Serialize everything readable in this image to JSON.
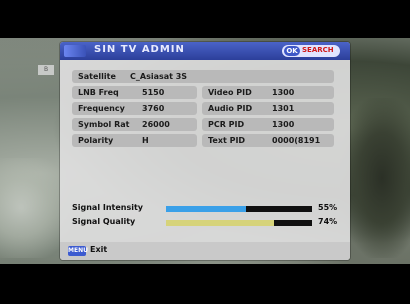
{
  "window": {
    "title": "SIN TV ADMIN",
    "ok_key": "OK",
    "ok_action": "SEARCH",
    "side_tab": "B"
  },
  "info": {
    "satellite_label": "Satellite",
    "satellite_value": "C_Asiasat 3S",
    "lnb_label": "LNB Freq",
    "lnb_value": "5150",
    "frequency_label": "Frequency",
    "frequency_value": "3760",
    "symbol_label": "Symbol Rat",
    "symbol_value": "26000",
    "polarity_label": "Polarity",
    "polarity_value": "H",
    "video_pid_label": "Video PID",
    "video_pid_value": "1300",
    "audio_pid_label": "Audio PID",
    "audio_pid_value": "1301",
    "pcr_pid_label": "PCR PID",
    "pcr_pid_value": "1300",
    "text_pid_label": "Text PID",
    "text_pid_value": "0000(8191"
  },
  "signal": {
    "intensity_label": "Signal Intensity",
    "intensity_percent": "55%",
    "intensity_value": 55,
    "quality_label": "Signal Quality",
    "quality_percent": "74%",
    "quality_value": 74,
    "intensity_color": "#3aa0e8",
    "quality_color": "#d6d37a"
  },
  "footer": {
    "menu_key": "MENU",
    "exit_label": "Exit"
  }
}
